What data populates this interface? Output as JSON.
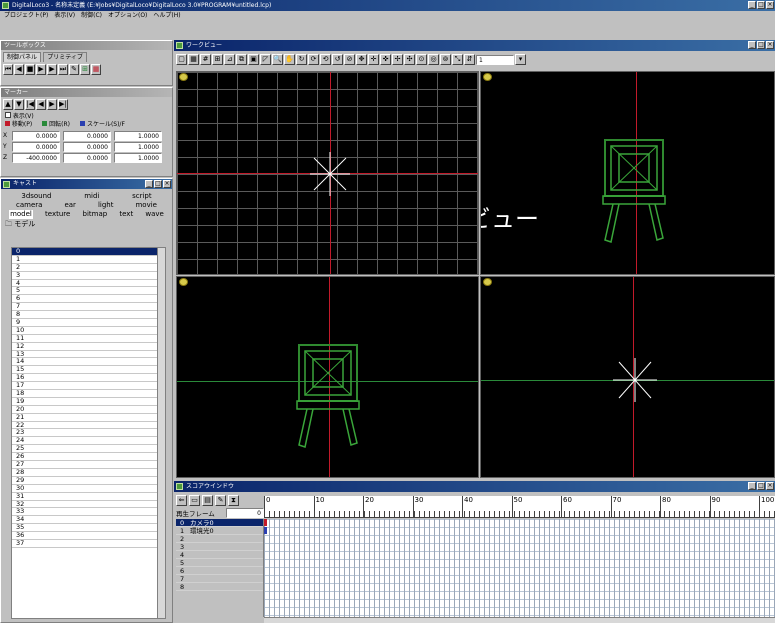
{
  "app": {
    "title": "DigitalLoco3 - 名称未定義 (E:¥Jobs¥DigitalLoco¥DigitalLoco 3.0¥PROGRAM¥untitled.lcp)"
  },
  "menu": [
    "プロジェクト(P)",
    "表示(V)",
    "制御(C)",
    "オプション(O)",
    "ヘルプ(H)"
  ],
  "tool_box": {
    "title": "ツールボックス",
    "tabs": [
      "制御パネル",
      "プリミティブ"
    ]
  },
  "marker": {
    "title": "マーカー",
    "display_label": "表示(V)",
    "legend": [
      "移動(P)",
      "回転(R)",
      "スケール(S)/F"
    ],
    "rows": [
      {
        "axis": "X",
        "move": "0.0000",
        "rotate": "0.0000",
        "scale": "1.0000"
      },
      {
        "axis": "Y",
        "move": "0.0000",
        "rotate": "0.0000",
        "scale": "1.0000"
      },
      {
        "axis": "Z",
        "move": "-400.0000",
        "rotate": "0.0000",
        "scale": "1.0000"
      }
    ]
  },
  "cast": {
    "title": "キャスト",
    "tab_rows": [
      [
        "3dsound",
        "midi",
        "script"
      ],
      [
        "camera",
        "ear",
        "light",
        "movie"
      ],
      [
        "model",
        "texture",
        "bitmap",
        "text",
        "wave"
      ]
    ],
    "folder_label": "モデル",
    "rows": [
      "0",
      "1",
      "2",
      "3",
      "4",
      "5",
      "6",
      "7",
      "8",
      "9",
      "10",
      "11",
      "12",
      "13",
      "14",
      "15",
      "16",
      "17",
      "18",
      "19",
      "20",
      "21",
      "22",
      "23",
      "24",
      "25",
      "26",
      "27",
      "28",
      "29",
      "30",
      "31",
      "32",
      "33",
      "34",
      "35",
      "36",
      "37"
    ]
  },
  "workview": {
    "title": "ワークビュー",
    "frame_value": "1",
    "overlay_label": "ワークビュー"
  },
  "score": {
    "title": "スコアウインドウ",
    "frame_label": "再生フレーム",
    "frame_value": "0",
    "ruler": [
      "0",
      "10",
      "20",
      "30",
      "40",
      "50",
      "60",
      "70",
      "80",
      "90",
      "100"
    ],
    "rows": [
      {
        "num": "0",
        "name": "カメラ0"
      },
      {
        "num": "1",
        "name": "環境光0"
      },
      {
        "num": "2",
        "name": ""
      },
      {
        "num": "3",
        "name": ""
      },
      {
        "num": "4",
        "name": ""
      },
      {
        "num": "5",
        "name": ""
      },
      {
        "num": "6",
        "name": ""
      },
      {
        "num": "7",
        "name": ""
      },
      {
        "num": "8",
        "name": ""
      }
    ]
  }
}
